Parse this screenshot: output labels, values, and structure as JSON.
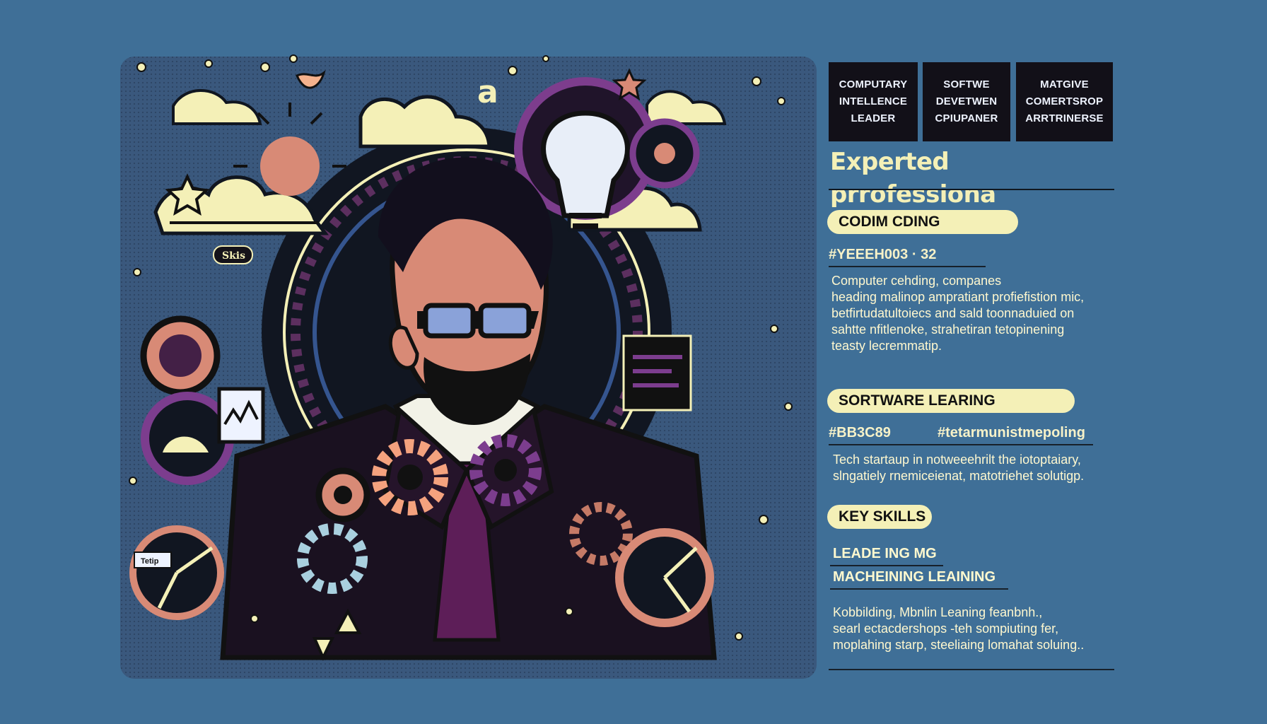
{
  "summary": {
    "boxes": [
      {
        "lines": [
          "COMPUTARY",
          "INTELLENCE",
          "LEADER"
        ]
      },
      {
        "lines": [
          "SOFTWE",
          "DEVETWEN",
          "CPIUPANER"
        ]
      },
      {
        "lines": [
          "MATGIVE",
          "COMERTSROP",
          "ARRTRINERSE"
        ]
      }
    ],
    "headline": "Experted prrofessiona"
  },
  "sections": {
    "coding": {
      "title": "CODIM  CDING",
      "code": "#YEEEH003 · 32",
      "lines": [
        "Computer cehding, companes",
        "heading malinop ampratiant profiefistion mic,",
        "betfirtudatultoiecs and sald toonnaduied on",
        "sahtte nfitlenoke, strahetiran tetopinening",
        "teasty lecremmatip."
      ]
    },
    "learning": {
      "title": "SORTWARE LEARING",
      "code_left": "#BB3C89",
      "code_right": "#tetarmunistmepoling",
      "lines": [
        "Tech startaup in notweeehrilt the iotoptaiary,",
        "slngatiely rnemiceienat, matotriehet solutigp."
      ]
    },
    "skills": {
      "title": "KEY SKILLS",
      "items": [
        "LEADE ING MG",
        "MACHEINING LEAINING"
      ],
      "lines": [
        "Kobbilding, Mbnlin Leaning feanbnh.,",
        "searl ectacdershops -teh sompiuting fer,",
        "moplahing starp, steeliaing lomahat soluing.."
      ]
    }
  },
  "art": {
    "subject": "bearded professional with glasses",
    "icons": [
      "cloud-icon",
      "lightbulb-icon",
      "gear-icon",
      "star-icon",
      "triangle-icon",
      "chart-icon",
      "sun-icon",
      "bird-icon"
    ],
    "small_text": "Skis",
    "small_tag": "Tetip",
    "letter": "a",
    "colors": {
      "background": "#3f6f97",
      "cream": "#f4f0b7",
      "purple": "#7c3d8e",
      "coral": "#d88a76",
      "navy": "#142034",
      "blue": "#3b587d"
    }
  }
}
